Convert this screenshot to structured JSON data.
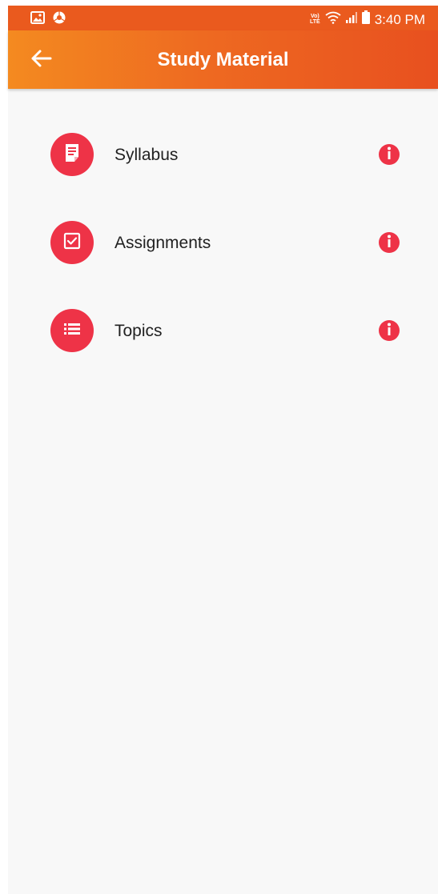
{
  "status_bar": {
    "time": "3:40 PM",
    "volte_line1": "Vo)",
    "volte_line2": "LTE",
    "left_icons": [
      "gallery-icon",
      "chrome-icon"
    ],
    "right_icons": [
      "volte-icon",
      "wifi-icon",
      "signal-icon",
      "battery-icon"
    ]
  },
  "app_bar": {
    "title": "Study Material",
    "back_icon": "arrow-back-icon"
  },
  "items": [
    {
      "label": "Syllabus",
      "icon": "document-icon",
      "info_icon": "info-icon"
    },
    {
      "label": "Assignments",
      "icon": "checkbox-icon",
      "info_icon": "info-icon"
    },
    {
      "label": "Topics",
      "icon": "list-icon",
      "info_icon": "info-icon"
    }
  ],
  "colors": {
    "status_bar": "#ea5a1e",
    "app_bar_start": "#f48a20",
    "app_bar_end": "#e8501f",
    "accent": "#ee3347",
    "background": "#f8f8f8"
  }
}
